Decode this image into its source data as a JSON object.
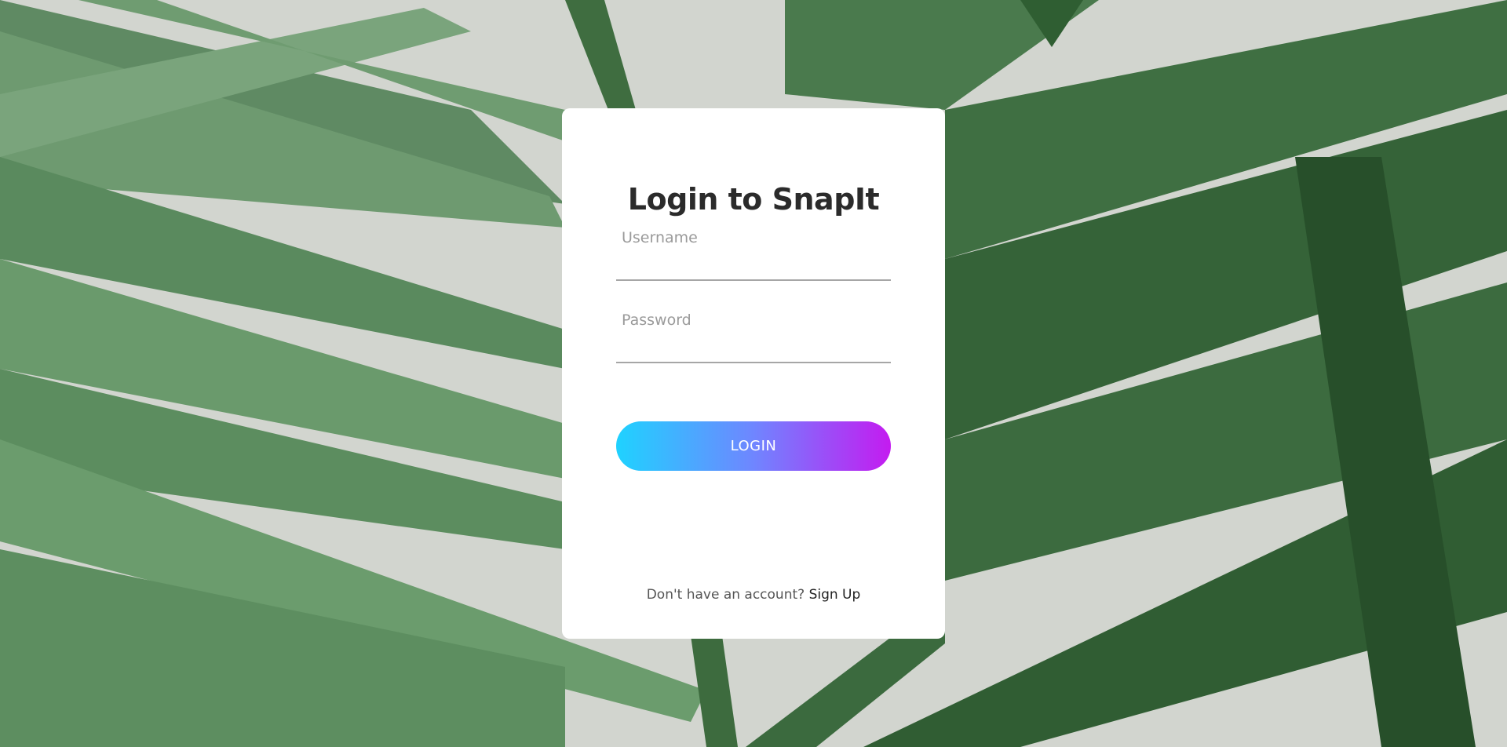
{
  "login_card": {
    "title": "Login to SnapIt",
    "username_label": "Username",
    "username_value": "",
    "password_label": "Password",
    "password_value": "",
    "login_button_label": "LOGIN",
    "signup_prompt": "Don't have an account?",
    "signup_link": "Sign Up"
  },
  "colors": {
    "card_background": "#ffffff",
    "button_gradient_start": "#1fd2ff",
    "button_gradient_mid": "#6f86ff",
    "button_gradient_end": "#c41bf0",
    "title_color": "#2b2b2b",
    "label_color": "#9a9a9a",
    "background_theme": "green palm leaves photo"
  }
}
